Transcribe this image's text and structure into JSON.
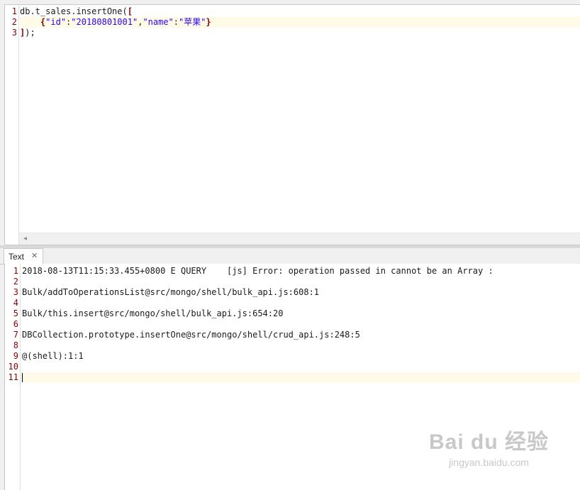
{
  "editor": {
    "lines": [
      {
        "num": "1",
        "parts": [
          {
            "t": "db.t_sales.insertOne(",
            "c": ""
          },
          {
            "t": "[",
            "c": "bracket"
          }
        ]
      },
      {
        "num": "2",
        "parts": [
          {
            "t": "    ",
            "c": ""
          },
          {
            "t": "{",
            "c": "bracket"
          },
          {
            "t": "\"id\"",
            "c": "str"
          },
          {
            "t": ":",
            "c": ""
          },
          {
            "t": "\"20180801001\"",
            "c": "str"
          },
          {
            "t": ",",
            "c": ""
          },
          {
            "t": "\"name\"",
            "c": "str"
          },
          {
            "t": ":",
            "c": ""
          },
          {
            "t": "\"苹果\"",
            "c": "str"
          },
          {
            "t": "}",
            "c": "bracket"
          }
        ]
      },
      {
        "num": "3",
        "parts": [
          {
            "t": "]",
            "c": "bracket"
          },
          {
            "t": ");",
            "c": ""
          }
        ]
      }
    ],
    "highlight_line": 2,
    "scroll_left_arrow": "◂"
  },
  "console_tab": {
    "label": "Text",
    "close_icon": "✕"
  },
  "console": {
    "lines": [
      {
        "num": "1",
        "text": "2018-08-13T11:15:33.455+0800 E QUERY    [js] Error: operation passed in cannot be an Array :"
      },
      {
        "num": "2",
        "text": ""
      },
      {
        "num": "3",
        "text": "Bulk/addToOperationsList@src/mongo/shell/bulk_api.js:608:1"
      },
      {
        "num": "4",
        "text": ""
      },
      {
        "num": "5",
        "text": "Bulk/this.insert@src/mongo/shell/bulk_api.js:654:20"
      },
      {
        "num": "6",
        "text": ""
      },
      {
        "num": "7",
        "text": "DBCollection.prototype.insertOne@src/mongo/shell/crud_api.js:248:5"
      },
      {
        "num": "8",
        "text": ""
      },
      {
        "num": "9",
        "text": "@(shell):1:1"
      },
      {
        "num": "10",
        "text": ""
      },
      {
        "num": "11",
        "text": ""
      }
    ],
    "highlight_line": 11
  },
  "watermark": {
    "logo": "Bai du 经验",
    "url": "jingyan.baidu.com"
  }
}
